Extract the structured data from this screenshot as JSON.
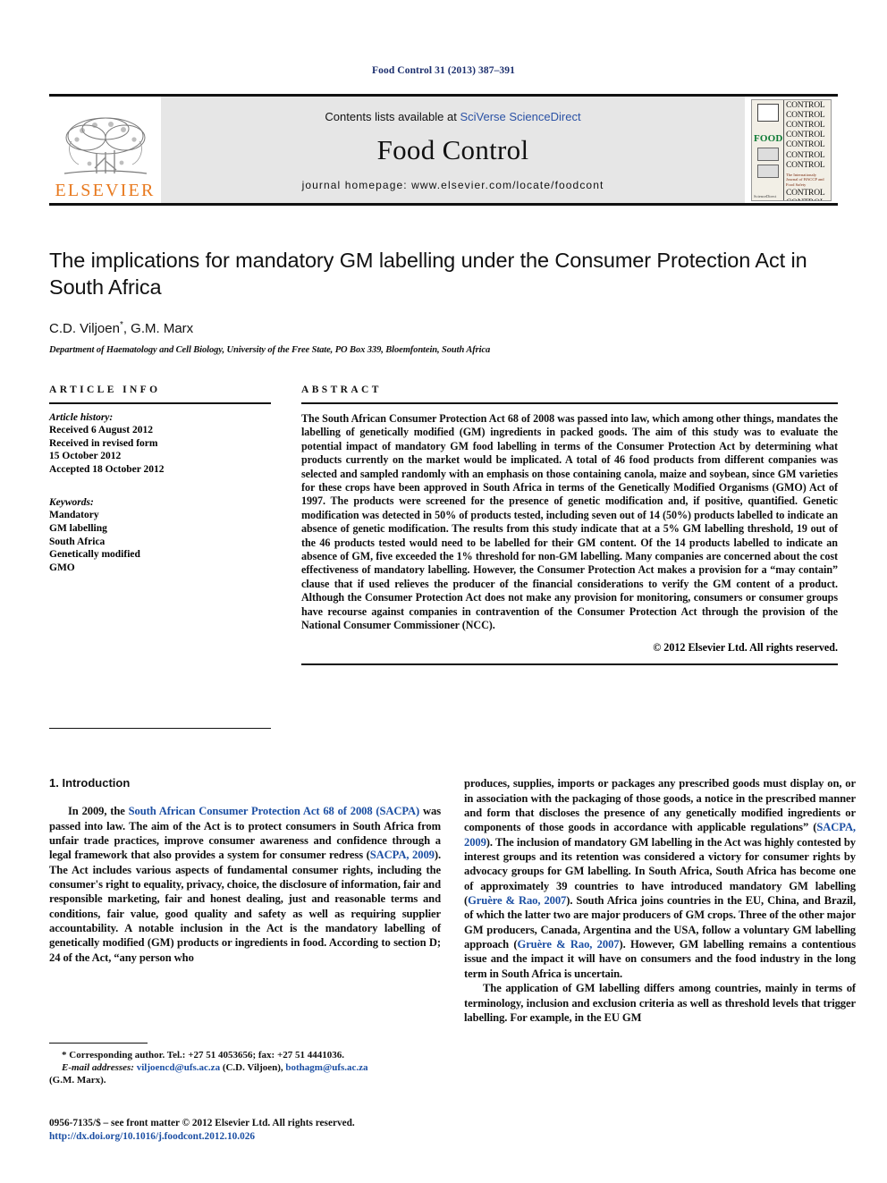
{
  "running_head": "Food Control 31 (2013) 387–391",
  "masthead": {
    "publisher_name": "ELSEVIER",
    "contents_prefix": "Contents lists available at ",
    "contents_link": "SciVerse ScienceDirect",
    "journal_name": "Food Control",
    "homepage": "journal homepage: www.elsevier.com/locate/foodcont",
    "cover": {
      "food_word": "FOOD",
      "control_word": "CONTROL",
      "subtitle": "The Internationaly Journal of HACCP and Food Safety",
      "bottom_note": "ScienceDirect"
    }
  },
  "article": {
    "title": "The implications for mandatory GM labelling under the Consumer Protection Act in South Africa",
    "authors": "C.D. Viljoen",
    "authors_rest": ", G.M. Marx",
    "author_marker": "*",
    "affiliation": "Department of Haematology and Cell Biology, University of the Free State, PO Box 339, Bloemfontein, South Africa"
  },
  "info": {
    "label": "ARTICLE INFO",
    "history_title": "Article history:",
    "history": [
      "Received 6 August 2012",
      "Received in revised form",
      "15 October 2012",
      "Accepted 18 October 2012"
    ],
    "keywords_title": "Keywords:",
    "keywords": [
      "Mandatory",
      "GM labelling",
      "South Africa",
      "Genetically modified",
      "GMO"
    ]
  },
  "abstract": {
    "label": "ABSTRACT",
    "text": "The South African Consumer Protection Act 68 of 2008 was passed into law, which among other things, mandates the labelling of genetically modified (GM) ingredients in packed goods. The aim of this study was to evaluate the potential impact of mandatory GM food labelling in terms of the Consumer Protection Act by determining what products currently on the market would be implicated. A total of 46 food products from different companies was selected and sampled randomly with an emphasis on those containing canola, maize and soybean, since GM varieties for these crops have been approved in South Africa in terms of the Genetically Modified Organisms (GMO) Act of 1997. The products were screened for the presence of genetic modification and, if positive, quantified. Genetic modification was detected in 50% of products tested, including seven out of 14 (50%) products labelled to indicate an absence of genetic modification. The results from this study indicate that at a 5% GM labelling threshold, 19 out of the 46 products tested would need to be labelled for their GM content. Of the 14 products labelled to indicate an absence of GM, five exceeded the 1% threshold for non-GM labelling. Many companies are concerned about the cost effectiveness of mandatory labelling. However, the Consumer Protection Act makes a provision for a “may contain” clause that if used relieves the producer of the financial considerations to verify the GM content of a product. Although the Consumer Protection Act does not make any provision for monitoring, consumers or consumer groups have recourse against companies in contravention of the Consumer Protection Act through the provision of the National Consumer Commissioner (NCC).",
    "copyright": "© 2012 Elsevier Ltd. All rights reserved."
  },
  "body": {
    "section_heading": "1. Introduction",
    "left_paragraph_1_a": "In 2009, the ",
    "left_paragraph_1_cite1": "South African Consumer Protection Act 68 of 2008 (SACPA)",
    "left_paragraph_1_b": " was passed into law. The aim of the Act is to protect consumers in South Africa from unfair trade practices, improve consumer awareness and confidence through a legal framework that also provides a system for consumer redress (",
    "left_paragraph_1_cite2": "SACPA, 2009",
    "left_paragraph_1_c": "). The Act includes various aspects of fundamental consumer rights, including the consumer's right to equality, privacy, choice, the disclosure of information, fair and responsible marketing, fair and honest dealing, just and reasonable terms and conditions, fair value, good quality and safety as well as requiring supplier accountability. A notable inclusion in the Act is the mandatory labelling of genetically modified (GM) products or ingredients in food. According to section D; 24 of the Act, “any person who",
    "right_paragraph_1_a": "produces, supplies, imports or packages any prescribed goods must display on, or in association with the packaging of those goods, a notice in the prescribed manner and form that discloses the presence of any genetically modified ingredients or components of those goods in accordance with applicable regulations” (",
    "right_paragraph_1_cite1": "SACPA, 2009",
    "right_paragraph_1_b": "). The inclusion of mandatory GM labelling in the Act was highly contested by interest groups and its retention was considered a victory for consumer rights by advocacy groups for GM labelling. In South Africa, South Africa has become one of approximately 39 countries to have introduced mandatory GM labelling (",
    "right_paragraph_1_cite2": "Gruère & Rao, 2007",
    "right_paragraph_1_c": "). South Africa joins countries in the EU, China, and Brazil, of which the latter two are major producers of GM crops. Three of the other major GM producers, Canada, Argentina and the USA, follow a voluntary GM labelling approach (",
    "right_paragraph_1_cite3": "Gruère & Rao, 2007",
    "right_paragraph_1_d": "). However, GM labelling remains a contentious issue and the impact it will have on consumers and the food industry in the long term in South Africa is uncertain.",
    "right_paragraph_2": "The application of GM labelling differs among countries, mainly in terms of terminology, inclusion and exclusion criteria as well as threshold levels that trigger labelling. For example, in the EU GM"
  },
  "footnote": {
    "corresponding": "* Corresponding author. Tel.: +27 51 4053656; fax: +27 51 4441036.",
    "email_label": "E-mail addresses:",
    "email1": "viljoencd@ufs.ac.za",
    "email1_owner": "(C.D. Viljoen),",
    "email2": "bothagm@ufs.ac.za",
    "email2_owner": "(G.M. Marx).",
    "imprint": "0956-7135/$ – see front matter © 2012 Elsevier Ltd. All rights reserved.",
    "doi": "http://dx.doi.org/10.1016/j.foodcont.2012.10.026"
  },
  "colors": {
    "running_head": "#1c2f6e",
    "link_blue": "#1c4fa3",
    "elsevier_orange": "#e8791e",
    "band_gray": "#e6e6e6",
    "cover_green": "#0a7a33"
  }
}
